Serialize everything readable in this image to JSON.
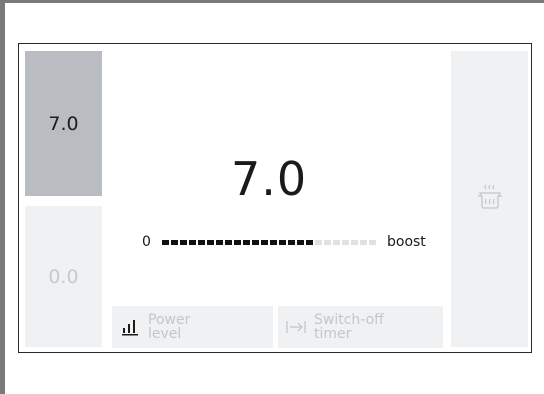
{
  "zones": [
    {
      "value": "7.0",
      "active": true
    },
    {
      "value": "0.0",
      "active": false
    }
  ],
  "main": {
    "value": "7.0",
    "scale_min": "0",
    "scale_max": "boost",
    "level": 0.7
  },
  "tiles": {
    "power": {
      "line1": "Power",
      "line2": "level",
      "icon": "bars-icon"
    },
    "timer": {
      "line1": "Switch-off",
      "line2": "timer",
      "icon": "arrow-to-line-icon"
    }
  },
  "side_panel": {
    "icon": "pot-steam-icon"
  },
  "colors": {
    "active_zone": "#b9bcc0",
    "inactive": "#f0f1f2",
    "bar_on": "#111111",
    "bar_off": "#dfe1e3"
  }
}
